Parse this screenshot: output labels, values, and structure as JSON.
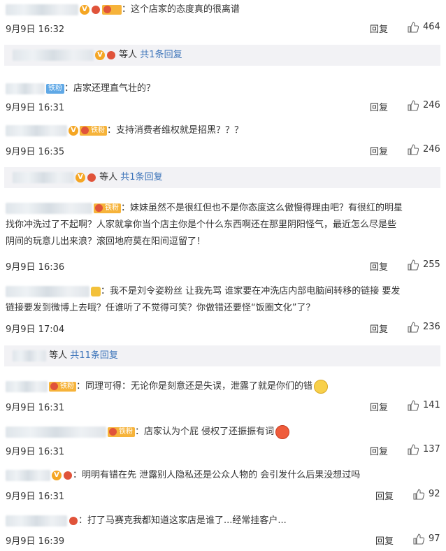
{
  "reply_label": "回复",
  "comments": [
    {
      "text": "：这个店家的态度真的很离谱",
      "time": "9月9日 16:32",
      "likes": "464"
    },
    {
      "fan_badge": "铁粉",
      "text": "：店家还理直气壮的？",
      "time": "9月9日 16:31",
      "likes": "246"
    },
    {
      "fan_badge": "铁粉",
      "text": "：支持消费者维权就是招黑？？？",
      "time": "9月9日 16:35",
      "likes": "246"
    },
    {
      "fan_badge": "铁粉",
      "text": "：妹妹虽然不是很红但也不是你态度这么傲慢得理由吧？有很红的明星",
      "text2": "找你冲洗过了不起啊？人家就拿你当个店主你是个什么东西啊还在那里阴阳怪气，最近怎么尽是些",
      "text3": "阴间的玩意儿出来浪？滚回地府莫在阳间逗留了！",
      "time": "9月9日 16:36",
      "likes": "255"
    },
    {
      "text": "：我不是刘令姿粉丝 让我先骂 谁家要在冲洗店内部电脑间转移的链接 要发",
      "text2": "链接要发到微博上去哦？任谁听了不觉得可笑？你做错还要怪“饭圈文化”了？",
      "time": "9月9日 17:04",
      "likes": "236"
    },
    {
      "fan_badge": "铁粉",
      "text": "：同理可得：无论你是刻意还是失误，泄露了就是你们的错",
      "time": "9月9日 16:31",
      "likes": "141"
    },
    {
      "fan_badge": "铁粉",
      "text": "：店家认为个屁 侵权了还振振有词",
      "time": "9月9日 16:31",
      "likes": "137"
    },
    {
      "text": "：明明有错在先 泄露别人隐私还是公众人物的 会引发什么后果没想过吗",
      "time": "9月9日 16:31",
      "likes": "92"
    },
    {
      "text": "：打了马赛克我都知道这家店是谁了...经常挂客户...",
      "time": "9月9日 16:39",
      "likes": "97"
    }
  ],
  "subthreads": [
    {
      "people": "等人",
      "more": "共1条回复"
    },
    {
      "people": "等人",
      "more": "共1条回复"
    },
    {
      "people": "等人",
      "more": "共11条回复"
    }
  ],
  "icons": {
    "verified": "V",
    "thumb": "thumbs-up-icon"
  }
}
